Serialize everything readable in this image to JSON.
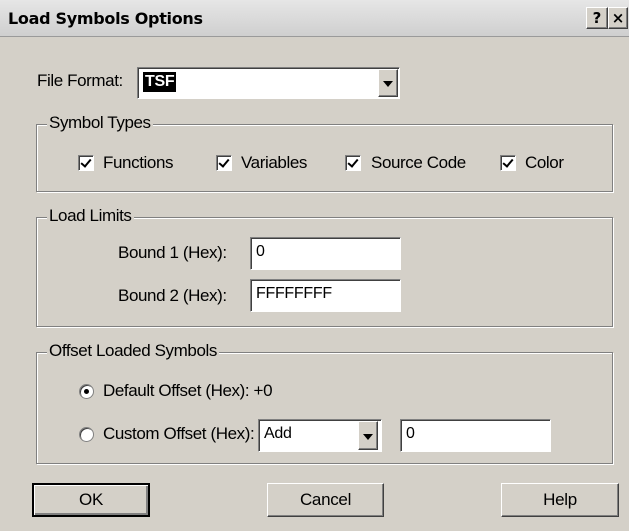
{
  "window": {
    "title": "Load Symbols Options",
    "help_button": "?",
    "close_button": "×"
  },
  "file_format": {
    "label": "File Format:",
    "value": "TSF"
  },
  "symbol_types": {
    "title": "Symbol Types",
    "options": [
      {
        "label": "Functions",
        "checked": true
      },
      {
        "label": "Variables",
        "checked": true
      },
      {
        "label": "Source Code",
        "checked": true
      },
      {
        "label": "Color",
        "checked": true
      }
    ]
  },
  "load_limits": {
    "title": "Load Limits",
    "bound1_label": "Bound 1 (Hex):",
    "bound1_value": "0",
    "bound2_label": "Bound 2 (Hex):",
    "bound2_value": "FFFFFFFF"
  },
  "offset": {
    "title": "Offset Loaded Symbols",
    "default_label": "Default Offset (Hex): +0",
    "default_selected": true,
    "custom_label": "Custom Offset (Hex):",
    "custom_selected": false,
    "operation_value": "Add",
    "custom_value": "0"
  },
  "buttons": {
    "ok": "OK",
    "cancel": "Cancel",
    "help": "Help"
  }
}
